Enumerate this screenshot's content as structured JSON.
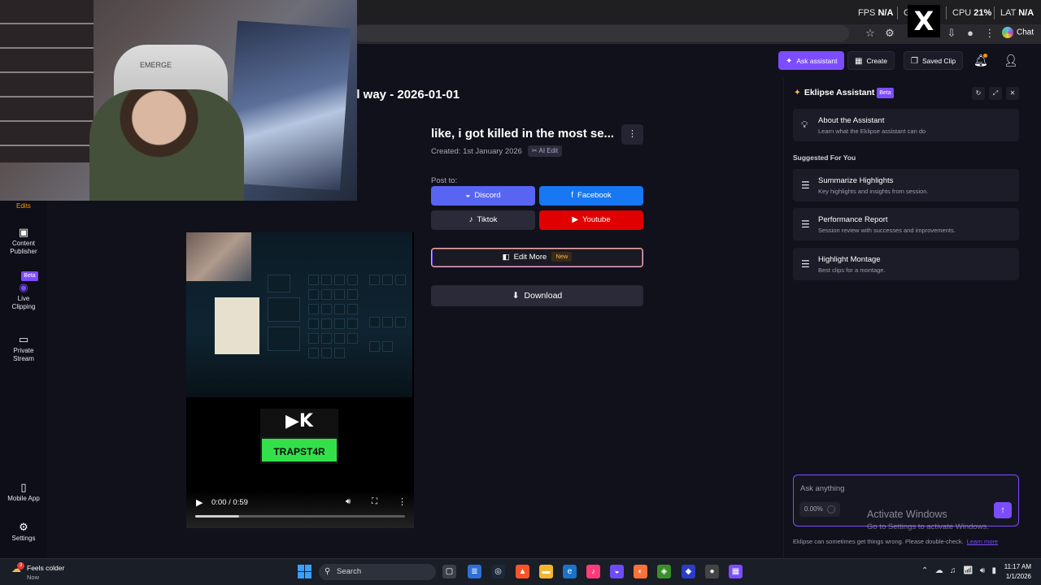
{
  "overlay": {
    "hud": {
      "fps_label": "FPS",
      "fps_value": "N/A",
      "gpu_label": "GP",
      "cpu_label": "CPU",
      "cpu_value": "21",
      "lat_label": "LAT",
      "lat_value": "N/A"
    },
    "camera_tag": "EMERGE"
  },
  "browser": {
    "chat_label": "Chat",
    "icons": [
      "star-icon",
      "extensions-icon",
      "sync-icon",
      "download-icon",
      "profile-icon",
      "menu-icon"
    ]
  },
  "header": {
    "ask_assistant": "Ask assistant",
    "create": "Create",
    "saved_clip": "Saved Clip"
  },
  "page": {
    "title": "al way - 2026-01-01"
  },
  "sidebar": {
    "edits": "Edits",
    "items": [
      {
        "label_1": "Content",
        "label_2": "Publisher"
      },
      {
        "label_1": "Live",
        "label_2": "Clipping",
        "badge": "Beta"
      },
      {
        "label_1": "Private",
        "label_2": "Stream"
      },
      {
        "label_1": "Mobile App"
      },
      {
        "label_1": "Settings"
      }
    ]
  },
  "player": {
    "time": "0:00 / 0:59",
    "progress_fraction": 0.21,
    "streamer_tag": "TRAPST4R",
    "sponsor_logos": "▶K"
  },
  "clip": {
    "title": "like, i got killed in the most se...",
    "created": "Created: 1st January 2026",
    "ai_badge": "AI Edit",
    "post_to": "Post to:",
    "share": {
      "discord": "Discord",
      "facebook": "Facebook",
      "tiktok": "Tiktok",
      "youtube": "Youtube"
    },
    "edit_more": "Edit More",
    "edit_more_badge": "New",
    "download": "Download"
  },
  "assistant": {
    "title": "Eklipse Assistant",
    "badge": "Beta",
    "about_title": "About the Assistant",
    "about_sub": "Learn what the Eklipse assistant can do",
    "suggested_label": "Suggested For You",
    "suggestions": [
      {
        "title": "Summarize Highlights",
        "sub": "Key highlights and insights from session."
      },
      {
        "title": "Performance Report",
        "sub": "Session review with successes and improvements."
      },
      {
        "title": "Highlight Montage",
        "sub": "Best clips for a montage."
      }
    ],
    "input_placeholder": "Ask anything",
    "usage": "0.00%",
    "disclaimer": "Eklipse can sometimes get things wrong. Please double-check.",
    "learn_more": "Learn more"
  },
  "watermark": {
    "line1": "Activate Windows",
    "line2": "Go to Settings to activate Windows."
  },
  "taskbar": {
    "weather_title": "Feels colder",
    "weather_sub": "Now",
    "weather_badge": "3",
    "search_label": "Search",
    "time": "11:17 AM",
    "date": "1/1/2026"
  },
  "colors": {
    "accent": "#7c4dff",
    "discord": "#5865f2",
    "facebook": "#1877f2",
    "youtube": "#e00000",
    "streamer_green": "#33e04a"
  }
}
